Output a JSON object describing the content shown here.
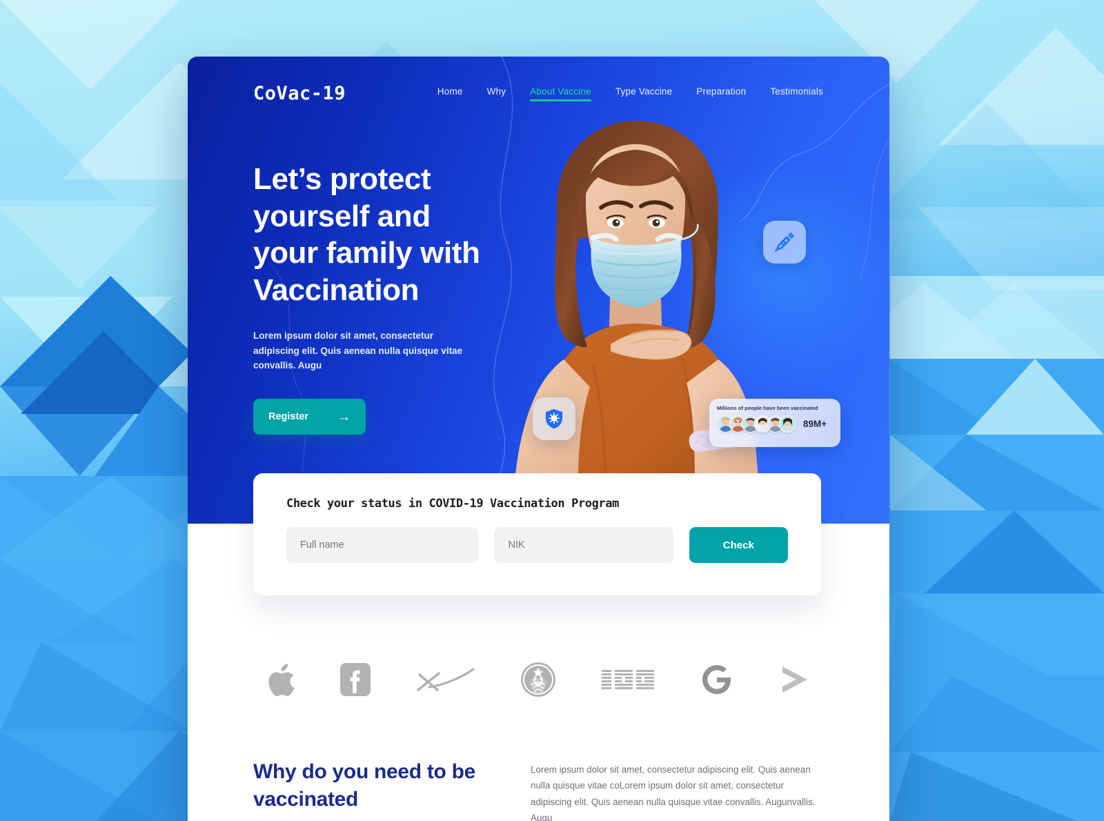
{
  "site": {
    "brand": "CoVac-19",
    "nav": [
      {
        "label": "Home",
        "active": false
      },
      {
        "label": "Why",
        "active": false
      },
      {
        "label": "About Vaccine",
        "active": true
      },
      {
        "label": "Type Vaccine",
        "active": false
      },
      {
        "label": "Preparation",
        "active": false
      },
      {
        "label": "Testimonials",
        "active": false
      }
    ]
  },
  "hero": {
    "title_line1": "Let’s protect",
    "title_line2": "yourself and",
    "title_line3": "your family with",
    "title_line4": "Vaccination",
    "subtitle": "Lorem ipsum dolor sit amet, consectetur adipiscing elit. Quis aenean nulla quisque vitae convallis. Augu",
    "register_label": "Register",
    "register_arrow": "→",
    "badges": [
      {
        "name": "syringe-icon"
      },
      {
        "name": "shield-virus-icon"
      }
    ]
  },
  "stat_card": {
    "label": "Millions of people have been vaccinated",
    "value": "89M+",
    "avatar_count": 6
  },
  "status_form": {
    "title": "Check your status in COVID-19 Vaccination Program",
    "fullname_placeholder": "Full name",
    "fullname_value": "",
    "nik_placeholder": "NIK",
    "nik_value": "",
    "check_label": "Check"
  },
  "logos": [
    {
      "name": "apple-logo"
    },
    {
      "name": "facebook-logo"
    },
    {
      "name": "spacex-logo"
    },
    {
      "name": "starbucks-logo"
    },
    {
      "name": "ibm-logo"
    },
    {
      "name": "google-logo"
    },
    {
      "name": "chevron-logo"
    }
  ],
  "why": {
    "title": "Why do you need to be vaccinated",
    "text": "Lorem ipsum dolor sit amet, consectetur adipiscing elit. Quis aenean nulla quisque vitae coLorem ipsum dolor sit amet, consectetur adipiscing elit. Quis aenean nulla quisque vitae convallis. Augunvallis. Augu"
  },
  "colors": {
    "hero_gradient_start": "#0a1f9e",
    "hero_gradient_end": "#3370ff",
    "accent_teal": "#00a3a8",
    "accent_green": "#19c98c",
    "heading_navy": "#1b2a8f",
    "backdrop_light": "#a9e7f7"
  }
}
